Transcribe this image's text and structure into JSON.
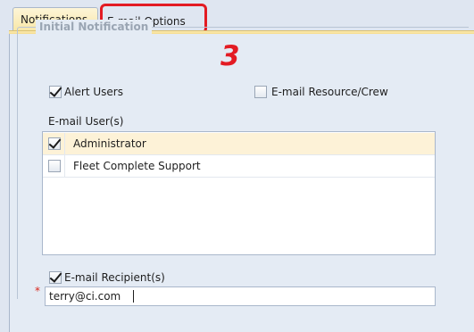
{
  "tabs": {
    "notifications": "Notifications",
    "email_options": "E-mail Options"
  },
  "annotation": {
    "step_number": "3",
    "color": "#e31b23"
  },
  "group": {
    "title": "Initial Notification",
    "alert_users": {
      "label": "Alert Users",
      "checked": true
    },
    "email_resource_crew": {
      "label": "E-mail Resource/Crew",
      "checked": false
    },
    "email_users_label": "E-mail User(s)",
    "users": [
      {
        "name": "Administrator",
        "checked": true,
        "selected": true
      },
      {
        "name": "Fleet Complete Support",
        "checked": false,
        "selected": false
      }
    ],
    "email_recipients": {
      "label": "E-mail Recipient(s)",
      "checked": true
    },
    "recipient_value": "terry@ci.com",
    "required_marker": "*"
  },
  "colors": {
    "active_tab": "#f8e7a6",
    "panel_background": "#e4ebf4",
    "selected_row": "#fdf2d7",
    "highlight": "#e31b23"
  }
}
